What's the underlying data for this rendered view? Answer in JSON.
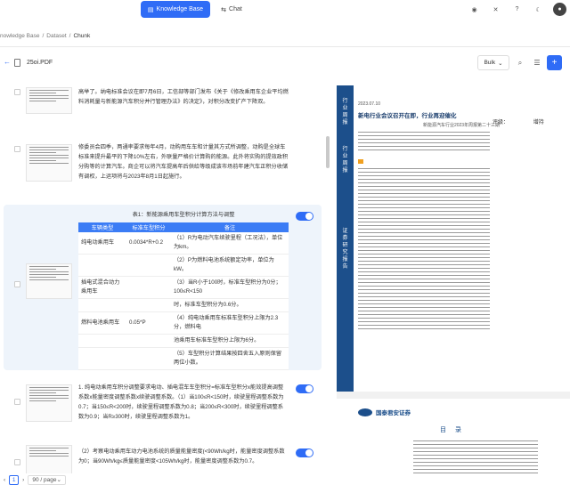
{
  "nav": {
    "knowledge_base": "Knowledge Base",
    "chat": "Chat"
  },
  "breadcrumb": {
    "root": "nowledge Base",
    "sep": "/",
    "dataset": "Dataset",
    "current": "Chunk"
  },
  "file": {
    "name": "25oi.PDF"
  },
  "toolbar": {
    "bulk_label": "Bulk"
  },
  "chunks": [
    {
      "text": "高举了。纳电标准会议在即7月6日，工信部等部门发布《关于《修改乘用车企业平均燃料消耗量与新能源汽车积分并行管理办法》的决定》，对积分改变扩产下降双。"
    },
    {
      "text": "修委员会四季，两通率要求每年4月，动购用车车和计量其方式所调整，动购是全球车标准来提升最平的下降10%左右，外联量严格价计算购的能源。此外将实购的提效政积分购等的计算汽车。商企可以将汽车提高年后供给等级成该市场前年建汽车正积分收储有调权，上运项将与2023年8月1日起施行。"
    },
    {
      "table_title": "表1：新能源乘用车型积分计算方法与调整",
      "headers": [
        "车辆类型",
        "标准车型积分",
        "备注"
      ],
      "rows": [
        [
          "纯电动乘用车",
          "0.0034*R+0.2",
          "（1）R为电动汽车续驶里程（工况法），单位为km。"
        ],
        [
          "",
          "",
          "（2）P为燃料电池系统额定功率，单位为kW。"
        ],
        [
          "插电式混合动力乘用车",
          "",
          "（3）当R小于100时，标准车型积分为0分；100≤R<150"
        ],
        [
          "",
          "",
          "时，标准车型积分为0.6分。"
        ],
        [
          "燃料电池乘用车",
          "0.05*P",
          "（4）纯电动乘用车标准车型积分上限为2.3分，燃料电"
        ],
        [
          "",
          "",
          "池乘用车标准车型积分上限为6分。"
        ],
        [
          "",
          "",
          "（5）车型积分计算结果按四舍五入原则保留两位小数。"
        ]
      ]
    },
    {
      "text": "1. 纯电动乘用车积分调整要求电动、插电混车车型积分=标准车型积分x能效提高调整系数x能量密度调整系数x续驶调整系数。（1）当100≤R<150时，续驶里程调整系数为0.7；当150≤R<200时，续驶里程调整系数为0.8；当200≤R<300时，续驶里程调整系数为0.9；当R≥300时，续驶里程调整系数为1。"
    },
    {
      "text": "（2）考察电动乘用车动力电池系统的质量能量密度(<90Wh/kg时，能量密度调整系数为0；当90Wh/kg≤质量能量密度<105Wh/kg时，能量密度调整系数为0.7。"
    }
  ],
  "pagination": {
    "page": "1",
    "per_page": "90 / page"
  },
  "preview": {
    "band": [
      "行业周报",
      "行业周报",
      "证券研究报告"
    ],
    "date": "2023.07.10",
    "title": "新电行业会议召开在即，行业再迎催化",
    "subtitle": "新能源汽车行业2023年周报第二十三期",
    "rating": "评级：",
    "rating_value": "增持",
    "logo": "国泰君安证券",
    "toc_title": "目 录"
  },
  "colors": {
    "accent": "#2f6cf6",
    "brand_band": "#1c4f8b"
  }
}
